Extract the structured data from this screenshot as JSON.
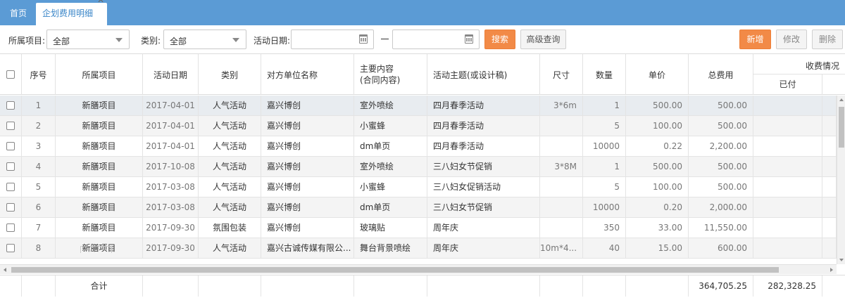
{
  "tabs": {
    "home": "首页",
    "active": "企划费用明细",
    "close": "✕"
  },
  "toolbar": {
    "project_label": "所属项目:",
    "project_value": "全部",
    "category_label": "类别:",
    "category_value": "全部",
    "date_label": "活动日期:",
    "date_from": "",
    "date_to": "",
    "search_button": "搜索",
    "advanced_button": "高级查询",
    "add_button": "新增",
    "edit_button": "修改",
    "delete_button": "删除"
  },
  "grid": {
    "headers": {
      "seq": "序号",
      "project": "所属项目",
      "date": "活动日期",
      "category": "类别",
      "counterparty": "对方单位名称",
      "content_line1": "主要内容",
      "content_line2": "(合同内容)",
      "theme": "活动主题(或设计稿)",
      "size": "尺寸",
      "qty": "数量",
      "unit_price": "单价",
      "total": "总费用",
      "charge_group": "收费情况",
      "paid": "已付"
    },
    "rows": [
      {
        "seq": "1",
        "project": "新膳项目",
        "date": "2017-04-01",
        "category": "人气活动",
        "counterparty": "嘉兴博创",
        "content": "室外喷绘",
        "theme": "四月春季活动",
        "size": "3*6m",
        "qty": "1",
        "unit_price": "500.00",
        "total": "500.00"
      },
      {
        "seq": "2",
        "project": "新膳项目",
        "date": "2017-04-01",
        "category": "人气活动",
        "counterparty": "嘉兴博创",
        "content": "小蜜蜂",
        "theme": "四月春季活动",
        "size": "",
        "qty": "5",
        "unit_price": "100.00",
        "total": "500.00"
      },
      {
        "seq": "3",
        "project": "新膳项目",
        "date": "2017-04-01",
        "category": "人气活动",
        "counterparty": "嘉兴博创",
        "content": "dm单页",
        "theme": "四月春季活动",
        "size": "",
        "qty": "10000",
        "unit_price": "0.22",
        "total": "2,200.00"
      },
      {
        "seq": "4",
        "project": "新膳项目",
        "date": "2017-10-08",
        "category": "人气活动",
        "counterparty": "嘉兴博创",
        "content": "室外喷绘",
        "theme": "三八妇女节促销",
        "size": "3*8M",
        "qty": "1",
        "unit_price": "500.00",
        "total": "500.00"
      },
      {
        "seq": "5",
        "project": "新膳项目",
        "date": "2017-03-08",
        "category": "人气活动",
        "counterparty": "嘉兴博创",
        "content": "小蜜蜂",
        "theme": "三八妇女促销活动",
        "size": "",
        "qty": "5",
        "unit_price": "100.00",
        "total": "500.00"
      },
      {
        "seq": "6",
        "project": "新膳项目",
        "date": "2017-03-08",
        "category": "人气活动",
        "counterparty": "嘉兴博创",
        "content": "dm单页",
        "theme": "三八妇女节促销",
        "size": "",
        "qty": "10000",
        "unit_price": "0.20",
        "total": "2,000.00"
      },
      {
        "seq": "7",
        "project": "新膳项目",
        "date": "2017-09-30",
        "category": "氛围包装",
        "counterparty": "嘉兴博创",
        "content": "玻璃贴",
        "theme": "周年庆",
        "size": "",
        "qty": "350",
        "unit_price": "33.00",
        "total": "11,550.00"
      },
      {
        "seq": "8",
        "project": "新膳项目",
        "date": "2017-09-30",
        "category": "人气活动",
        "counterparty": "嘉兴古诚传媒有限公...",
        "content": "舞台背景喷绘",
        "theme": "周年庆",
        "size": "10m*4...",
        "qty": "40",
        "unit_price": "15.00",
        "total": "600.00"
      }
    ],
    "footer": {
      "label": "合计",
      "total": "364,705.25",
      "paid": "282,328.25"
    }
  }
}
